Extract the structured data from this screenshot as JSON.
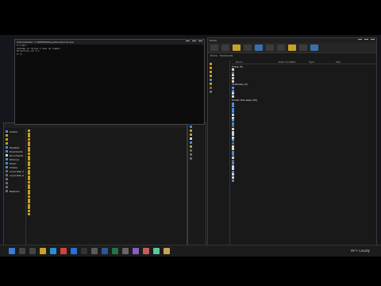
{
  "console": {
    "title": "Administrator: C:\\WINDOWS\\system32\\cmd.exe",
    "lines": [
      "C:\\>dir",
      "",
      "Volume in drive C has no label.",
      "",
      "Directory of C:\\",
      "",
      "",
      "",
      "",
      "",
      "",
      "",
      "",
      "",
      "",
      "",
      "",
      "",
      "",
      "",
      "",
      "",
      "",
      "",
      "",
      "C:\\>"
    ]
  },
  "leftExplorer": {
    "sidebar": [
      {
        "label": "Videos",
        "icon": "video-icon"
      },
      {
        "label": "",
        "icon": "folder-icon"
      },
      {
        "label": "",
        "icon": "folder-icon"
      },
      {
        "label": "",
        "icon": "folder-icon"
      },
      {
        "label": "Desktop",
        "icon": "desktop-icon"
      },
      {
        "label": "Downloads",
        "icon": "download-icon"
      },
      {
        "label": "Documents",
        "icon": "document-icon"
      },
      {
        "label": "Pictures",
        "icon": "picture-icon"
      },
      {
        "label": "Music",
        "icon": "music-icon"
      },
      {
        "label": "Videos",
        "icon": "video-icon"
      },
      {
        "label": "Local Disk (C:)",
        "icon": "drive-icon"
      },
      {
        "label": "Local Disk (D:)",
        "icon": "drive-icon"
      },
      {
        "label": "",
        "icon": "drive-icon"
      },
      {
        "label": "",
        "icon": "drive-icon"
      },
      {
        "label": "",
        "icon": "drive-icon"
      },
      {
        "label": "Network",
        "icon": "network-icon"
      }
    ],
    "files": [
      {
        "name": "",
        "date": "",
        "type": "",
        "size": "",
        "icon": "folder-icon"
      },
      {
        "name": "",
        "date": "",
        "type": "",
        "size": "",
        "icon": "folder-icon"
      },
      {
        "name": "",
        "date": "",
        "type": "",
        "size": "",
        "icon": "folder-icon"
      },
      {
        "name": "",
        "date": "",
        "type": "",
        "size": "",
        "icon": "folder-icon"
      },
      {
        "name": "",
        "date": "",
        "type": "",
        "size": "",
        "icon": "folder-icon"
      },
      {
        "name": "",
        "date": "",
        "type": "",
        "size": "",
        "icon": "folder-icon"
      },
      {
        "name": "",
        "date": "",
        "type": "",
        "size": "",
        "icon": "folder-icon"
      },
      {
        "name": "",
        "date": "",
        "type": "",
        "size": "",
        "icon": "folder-icon"
      },
      {
        "name": "",
        "date": "",
        "type": "",
        "size": "",
        "icon": "folder-icon"
      },
      {
        "name": "",
        "date": "",
        "type": "",
        "size": "",
        "icon": "folder-icon"
      },
      {
        "name": "",
        "date": "",
        "type": "",
        "size": "",
        "icon": "folder-icon"
      },
      {
        "name": "",
        "date": "",
        "type": "",
        "size": "",
        "icon": "folder-icon"
      },
      {
        "name": "",
        "date": "",
        "type": "",
        "size": "",
        "icon": "folder-icon"
      },
      {
        "name": "",
        "date": "",
        "type": "",
        "size": "",
        "icon": "folder-icon"
      },
      {
        "name": "",
        "date": "",
        "type": "",
        "size": "",
        "icon": "folder-icon"
      },
      {
        "name": "",
        "date": "",
        "type": "",
        "size": "",
        "icon": "folder-icon"
      },
      {
        "name": "",
        "date": "",
        "type": "",
        "size": "",
        "icon": "folder-icon"
      },
      {
        "name": "",
        "date": "",
        "type": "",
        "size": "",
        "icon": "folder-icon"
      },
      {
        "name": "",
        "date": "",
        "type": "",
        "size": "",
        "icon": "folder-icon"
      },
      {
        "name": "",
        "date": "",
        "type": "",
        "size": "",
        "icon": "folder-icon"
      },
      {
        "name": "",
        "date": "",
        "type": "",
        "size": "",
        "icon": "folder-icon"
      },
      {
        "name": "",
        "date": "",
        "type": "",
        "size": "",
        "icon": "folder-icon"
      },
      {
        "name": "",
        "date": "",
        "type": "",
        "size": "",
        "icon": "folder-icon"
      },
      {
        "name": "",
        "date": "",
        "type": "",
        "size": "",
        "icon": "folder-icon"
      },
      {
        "name": "",
        "date": "",
        "type": "",
        "size": "",
        "icon": "folder-icon"
      },
      {
        "name": "",
        "date": "",
        "type": "",
        "size": "",
        "icon": "folder-icon"
      },
      {
        "name": "",
        "date": "",
        "type": "",
        "size": "",
        "icon": "folder-icon"
      },
      {
        "name": "",
        "date": "",
        "type": "",
        "size": "",
        "icon": "folder-icon"
      },
      {
        "name": "",
        "date": "",
        "type": "",
        "size": "",
        "icon": "folder-icon"
      },
      {
        "name": "",
        "date": "",
        "type": "",
        "size": "",
        "icon": "folder-icon"
      }
    ]
  },
  "rightExplorer": {
    "tabs": [
      "Home",
      "Downloads"
    ],
    "address": "",
    "columns": [
      "Name",
      "Date modified",
      "Type",
      "Size"
    ],
    "groups": [
      {
        "label": "Today (5)",
        "files": [
          {
            "name": "",
            "date": "",
            "type": "",
            "size": "",
            "icon": "doc-icon"
          },
          {
            "name": "",
            "date": "",
            "type": "",
            "size": "",
            "icon": "app-icon"
          },
          {
            "name": "",
            "date": "",
            "type": "",
            "size": "",
            "icon": "doc-icon"
          },
          {
            "name": "",
            "date": "",
            "type": "",
            "size": "",
            "icon": "doc-icon"
          },
          {
            "name": "",
            "date": "",
            "type": "",
            "size": "",
            "icon": "doc-icon"
          }
        ]
      },
      {
        "label": "Yesterday (4)",
        "files": [
          {
            "name": "",
            "date": "",
            "type": "",
            "size": "",
            "icon": "img-icon"
          },
          {
            "name": "",
            "date": "",
            "type": "",
            "size": "",
            "icon": "img-icon"
          },
          {
            "name": "",
            "date": "",
            "type": "",
            "size": "",
            "icon": "doc-icon"
          },
          {
            "name": "",
            "date": "",
            "type": "",
            "size": "",
            "icon": "doc-icon"
          }
        ]
      },
      {
        "label": "Earlier this week (45)",
        "files": [
          {
            "name": "",
            "date": "",
            "type": "",
            "size": "",
            "icon": "img-icon"
          },
          {
            "name": "",
            "date": "",
            "type": "",
            "size": "",
            "icon": "img-icon"
          },
          {
            "name": "",
            "date": "",
            "type": "",
            "size": "",
            "icon": "img-icon"
          },
          {
            "name": "",
            "date": "",
            "type": "",
            "size": "",
            "icon": "img-icon"
          },
          {
            "name": "",
            "date": "",
            "type": "",
            "size": "",
            "icon": "doc-icon"
          },
          {
            "name": "",
            "date": "",
            "type": "",
            "size": "",
            "icon": "doc-icon"
          },
          {
            "name": "",
            "date": "",
            "type": "",
            "size": "",
            "icon": "img-icon"
          },
          {
            "name": "",
            "date": "",
            "type": "",
            "size": "",
            "icon": "img-icon"
          },
          {
            "name": "",
            "date": "",
            "type": "",
            "size": "",
            "icon": "app-icon"
          },
          {
            "name": "",
            "date": "",
            "type": "",
            "size": "",
            "icon": "doc-icon"
          },
          {
            "name": "",
            "date": "",
            "type": "",
            "size": "",
            "icon": "doc-icon"
          },
          {
            "name": "",
            "date": "",
            "type": "",
            "size": "",
            "icon": "doc-icon"
          },
          {
            "name": "",
            "date": "",
            "type": "",
            "size": "",
            "icon": "doc-icon"
          },
          {
            "name": "",
            "date": "",
            "type": "",
            "size": "",
            "icon": "img-icon"
          },
          {
            "name": "",
            "date": "",
            "type": "",
            "size": "",
            "icon": "app-icon"
          },
          {
            "name": "",
            "date": "",
            "type": "",
            "size": "",
            "icon": "doc-icon"
          },
          {
            "name": "",
            "date": "",
            "type": "",
            "size": "",
            "icon": "doc-icon"
          },
          {
            "name": "",
            "date": "",
            "type": "",
            "size": "",
            "icon": "img-icon"
          },
          {
            "name": "",
            "date": "",
            "type": "",
            "size": "",
            "icon": "img-icon"
          },
          {
            "name": "",
            "date": "",
            "type": "",
            "size": "",
            "icon": "doc-icon"
          },
          {
            "name": "",
            "date": "",
            "type": "",
            "size": "",
            "icon": "app-icon"
          },
          {
            "name": "",
            "date": "",
            "type": "",
            "size": "",
            "icon": "img-icon"
          },
          {
            "name": "",
            "date": "",
            "type": "",
            "size": "",
            "icon": "doc-icon"
          },
          {
            "name": "",
            "date": "",
            "type": "",
            "size": "",
            "icon": "doc-icon"
          },
          {
            "name": "",
            "date": "",
            "type": "",
            "size": "",
            "icon": "img-icon"
          },
          {
            "name": "",
            "date": "",
            "type": "",
            "size": "",
            "icon": "doc-icon"
          },
          {
            "name": "",
            "date": "",
            "type": "",
            "size": "",
            "icon": "doc-icon"
          },
          {
            "name": "",
            "date": "",
            "type": "",
            "size": "",
            "icon": "img-icon"
          }
        ]
      }
    ],
    "status": ""
  },
  "taskbar": {
    "icons": [
      {
        "icon": "start-icon",
        "color": "#3a7bd5"
      },
      {
        "icon": "search-icon",
        "color": "#444444"
      },
      {
        "icon": "taskview-icon",
        "color": "#444444"
      },
      {
        "icon": "explorer-icon",
        "color": "#c9a227"
      },
      {
        "icon": "edge-icon",
        "color": "#2a8fd6"
      },
      {
        "icon": "chrome-icon",
        "color": "#d0453b"
      },
      {
        "icon": "mail-icon",
        "color": "#2a6fd6"
      },
      {
        "icon": "terminal-icon",
        "color": "#333333"
      },
      {
        "icon": "store-icon",
        "color": "#5a5a5a"
      },
      {
        "icon": "word-icon",
        "color": "#2b579a"
      },
      {
        "icon": "excel-icon",
        "color": "#217346"
      },
      {
        "icon": "settings-icon",
        "color": "#666666"
      },
      {
        "icon": "app-icon",
        "color": "#8a5cc7"
      },
      {
        "icon": "app-icon",
        "color": "#c75c5c"
      },
      {
        "icon": "app-icon",
        "color": "#5cc79b"
      },
      {
        "icon": "app-icon",
        "color": "#c7a35c"
      }
    ],
    "weather": "49°F  Cloudy",
    "time": "",
    "date": ""
  }
}
